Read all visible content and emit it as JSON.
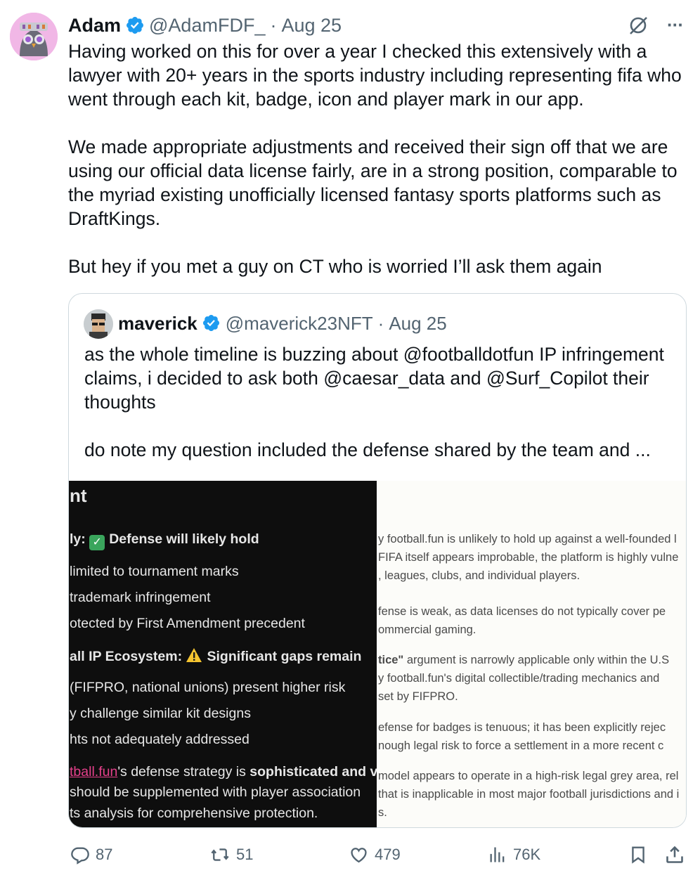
{
  "tweet": {
    "author_name": "Adam",
    "handle": "@AdamFDF_",
    "separator": "·",
    "date": "Aug 25",
    "more_label": "···",
    "text": "Having worked on this for over a year I checked this extensively with a\nlawyer with 20+ years in the sports industry including representing fifa who\nwent through each kit, badge, icon and player mark in our app.\n\nWe made appropriate adjustments and received their sign off that we are\nusing our official data license fairly, are in a strong position, comparable to\nthe myriad existing unofficially licensed fantasy sports platforms such as\nDraftKings.\n\nBut hey if you met a guy on CT who is worried I’ll ask them again"
  },
  "quote": {
    "author_name": "maverick",
    "handle": "@maverick23NFT",
    "separator": "·",
    "date": "Aug 25",
    "text": "as the whole timeline is buzzing about @footballdotfun IP infringement\nclaims, i decided to ask both @caesar_data and @Surf_Copilot their\nthoughts\n\ndo note my question included the defense shared by the team and ...",
    "image_dark": {
      "heading": "nt",
      "line1_prefix": "ly: ",
      "line1_bold": "Defense will likely hold",
      "line2": " limited to tournament marks",
      "line3": "trademark infringement",
      "line4": "otected by First Amendment precedent",
      "line5_a": "all IP Ecosystem: ",
      "line5_b": "Significant gaps remain",
      "line6": " (FIFPRO, national unions) present higher risk",
      "line7": "y challenge similar kit designs",
      "line8": "hts not adequately addressed",
      "line9_link": "tball.fun",
      "line9_mid": "'s defense strategy is ",
      "line9_bold": "sophisticated and v",
      "line10": "should be supplemented with player association",
      "line11": "ts analysis for comprehensive protection."
    },
    "image_light": {
      "l1": "y football.fun is unlikely to hold up against a well-founded l",
      "l2": " FIFA itself appears improbable, the platform is highly vulne",
      "l3": ", leagues, clubs, and individual players.",
      "l4": "fense is weak, as data licenses do not typically cover pe",
      "l5": "ommercial gaming.",
      "l6_bold": "tice\"",
      "l6_rest": " argument is narrowly applicable only within the U.S",
      "l7": "y football.fun's digital collectible/trading mechanics and",
      "l8": "set by FIFPRO.",
      "l9": "efense for badges is tenuous; it has been explicitly rejec",
      "l10": "nough legal risk to force a settlement in a more recent c",
      "l11": "model appears to operate in a high-risk legal grey area, rel",
      "l12": "that is inapplicable in most major football jurisdictions and i",
      "l13": "s."
    }
  },
  "actions": {
    "replies": "87",
    "reposts": "51",
    "likes": "479",
    "views": "76K"
  },
  "colors": {
    "verified": "#1d9bf0",
    "secondary_text": "#536471",
    "border": "#cfd9de",
    "avatar_bg": "#f1b7e6",
    "link_pink": "#e4408a"
  },
  "icons": [
    "verified-badge-icon",
    "grok-icon",
    "more-icon",
    "reply-icon",
    "repost-icon",
    "like-icon",
    "views-icon",
    "bookmark-icon",
    "share-icon",
    "check-emoji-icon",
    "warning-emoji-icon"
  ]
}
